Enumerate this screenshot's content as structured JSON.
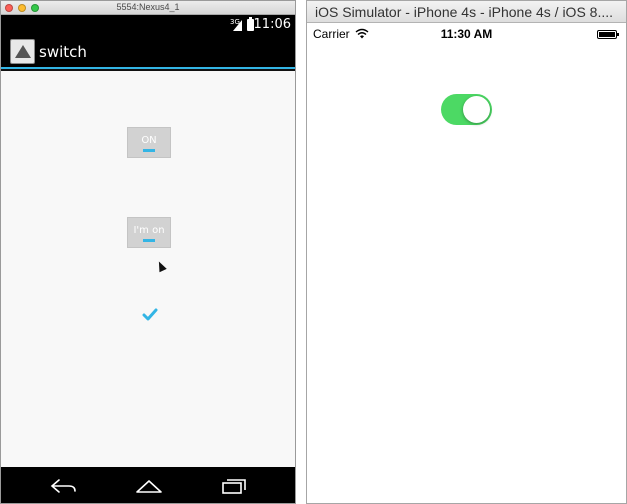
{
  "android": {
    "window_title": "5554:Nexus4_1",
    "status": {
      "network": "3G",
      "time": "11:06"
    },
    "action_bar": {
      "title": "switch",
      "icon": "app-launcher-icon"
    },
    "toggles": [
      {
        "label": "ON",
        "state": "on"
      },
      {
        "label": "I'm on",
        "state": "on"
      }
    ],
    "checkbox": {
      "checked": true,
      "icon": "checkmark-icon"
    },
    "nav": [
      "back-icon",
      "home-icon",
      "recents-icon"
    ],
    "accent_color": "#33b5e5"
  },
  "ios": {
    "window_title": "iOS Simulator - iPhone 4s - iPhone 4s / iOS 8....",
    "status": {
      "carrier": "Carrier",
      "time": "11:30 AM"
    },
    "switch": {
      "on": true,
      "color": "#4cd964"
    }
  }
}
